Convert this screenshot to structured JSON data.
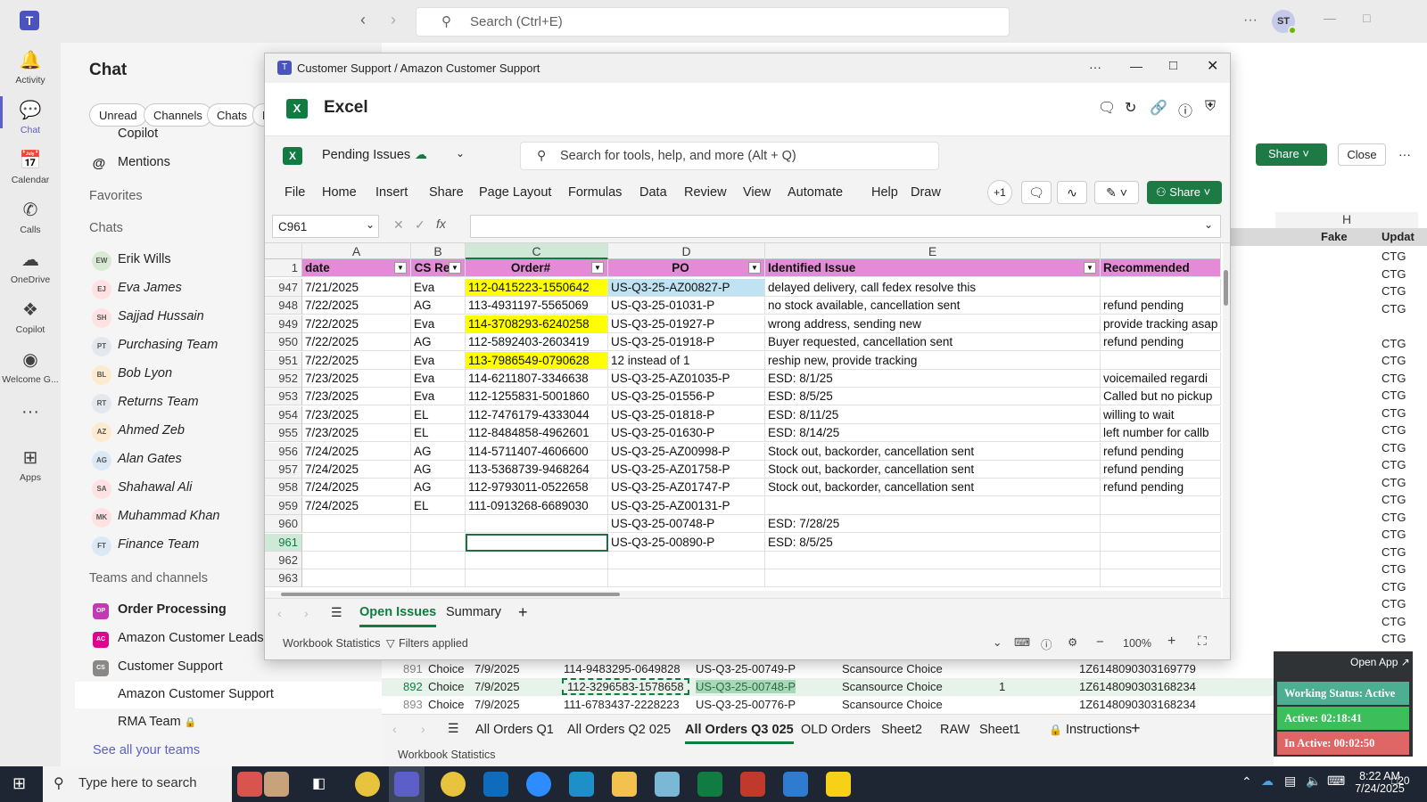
{
  "teams": {
    "search_placeholder": "Search (Ctrl+E)",
    "avatar": "ST",
    "rail": [
      "Activity",
      "Chat",
      "Calendar",
      "Calls",
      "OneDrive",
      "Copilot",
      "Welcome G...",
      "Apps"
    ],
    "chat_title": "Chat",
    "filters": [
      "Unread",
      "Channels",
      "Chats",
      "M"
    ],
    "copilot": "Copilot",
    "mentions": "Mentions",
    "favorites": "Favorites",
    "chats_header": "Chats",
    "chats": [
      {
        "initials": "EW",
        "name": "Erik Wills",
        "color": "#d9ead3"
      },
      {
        "initials": "EJ",
        "name": "Eva James",
        "color": "#fde2e1"
      },
      {
        "initials": "SH",
        "name": "Sajjad Hussain",
        "color": "#fde2e1"
      },
      {
        "initials": "PT",
        "name": "Purchasing Team",
        "color": "#e3e8ef"
      },
      {
        "initials": "BL",
        "name": "Bob Lyon",
        "color": "#fdebd0"
      },
      {
        "initials": "RT",
        "name": "Returns Team",
        "color": "#e3e8ef"
      },
      {
        "initials": "AZ",
        "name": "Ahmed Zeb",
        "color": "#fdebd0"
      },
      {
        "initials": "AG",
        "name": "Alan Gates",
        "color": "#dbe8f5"
      },
      {
        "initials": "SA",
        "name": "Shahawal Ali",
        "color": "#fde2e1"
      },
      {
        "initials": "MK",
        "name": "Muhammad Khan",
        "color": "#fde2e1"
      },
      {
        "initials": "FT",
        "name": "Finance Team",
        "color": "#dbe8f5"
      }
    ],
    "teams_header": "Teams and channels",
    "channels": [
      {
        "initials": "OP",
        "name": "Order Processing",
        "color": "#c239b3"
      },
      {
        "initials": "AC",
        "name": "Amazon Customer Leads",
        "color": "#e3008c"
      },
      {
        "initials": "CS",
        "name": "Customer Support",
        "color": "#8a8886"
      },
      {
        "initials": "",
        "name": "Amazon Customer Support",
        "color": ""
      },
      {
        "initials": "",
        "name": "RMA Team",
        "color": ""
      }
    ],
    "see_all": "See all your teams",
    "right_share": "Share",
    "right_close": "Close"
  },
  "window": {
    "title": "Customer Support / Amazon Customer Support",
    "app": "Excel",
    "file_name": "Pending Issues",
    "search_placeholder": "Search for tools, help, and more (Alt + Q)",
    "menus": [
      "File",
      "Home",
      "Insert",
      "Share",
      "Page Layout",
      "Formulas",
      "Data",
      "Review",
      "View",
      "Automate",
      "Help",
      "Draw"
    ],
    "collab": "+1",
    "share": "Share",
    "name_box": "C961",
    "fx": "fx",
    "columns": [
      "A",
      "B",
      "C",
      "D",
      "E"
    ],
    "header_row": {
      "num": "1",
      "date": "date",
      "cs": "CS Re",
      "order": "Order#",
      "po": "PO",
      "issue": "Identified Issue",
      "rec": "Recommended"
    },
    "rows": [
      {
        "n": "947",
        "date": "7/21/2025",
        "cs": "Eva",
        "order": "112-0415223-1550642",
        "po": "US-Q3-25-AZ00827-P",
        "issue": "delayed delivery, call fedex resolve this",
        "rec": "",
        "hl": "yel",
        "pohl": "blu"
      },
      {
        "n": "948",
        "date": "7/22/2025",
        "cs": "AG",
        "order": "113-4931197-5565069",
        "po": "US-Q3-25-01031-P",
        "issue": "no stock available, cancellation sent",
        "rec": "refund pending",
        "hl": "",
        "pohl": ""
      },
      {
        "n": "949",
        "date": "7/22/2025",
        "cs": "Eva",
        "order": "114-3708293-6240258",
        "po": "US-Q3-25-01927-P",
        "issue": "wrong address, sending new",
        "rec": "provide tracking asap",
        "hl": "yel",
        "pohl": ""
      },
      {
        "n": "950",
        "date": "7/22/2025",
        "cs": "AG",
        "order": "112-5892403-2603419",
        "po": "US-Q3-25-01918-P",
        "issue": "Buyer requested, cancellation sent",
        "rec": "refund pending",
        "hl": "",
        "pohl": ""
      },
      {
        "n": "951",
        "date": "7/22/2025",
        "cs": "Eva",
        "order": "113-7986549-0790628",
        "po": "12 instead of 1",
        "issue": "reship new, provide tracking",
        "rec": "",
        "hl": "yel",
        "pohl": ""
      },
      {
        "n": "952",
        "date": "7/23/2025",
        "cs": "Eva",
        "order": "114-6211807-3346638",
        "po": "US-Q3-25-AZ01035-P",
        "issue": " ESD: 8/1/25",
        "rec": "voicemailed regardi",
        "hl": "",
        "pohl": ""
      },
      {
        "n": "953",
        "date": "7/23/2025",
        "cs": "Eva",
        "order": "112-1255831-5001860",
        "po": "US-Q3-25-01556-P",
        "issue": "ESD: 8/5/25",
        "rec": "Called but no pickup",
        "hl": "",
        "pohl": ""
      },
      {
        "n": "954",
        "date": "7/23/2025",
        "cs": "EL",
        "order": "112-7476179-4333044",
        "po": "US-Q3-25-01818-P",
        "issue": "ESD: 8/11/25",
        "rec": "willing to wait",
        "hl": "",
        "pohl": ""
      },
      {
        "n": "955",
        "date": "7/23/2025",
        "cs": "EL",
        "order": "112-8484858-4962601",
        "po": "US-Q3-25-01630-P",
        "issue": " ESD: 8/14/25",
        "rec": "left number for callb",
        "hl": "",
        "pohl": ""
      },
      {
        "n": "956",
        "date": "7/24/2025",
        "cs": "AG",
        "order": "114-5711407-4606600",
        "po": "US-Q3-25-AZ00998-P",
        "issue": "Stock out, backorder, cancellation sent",
        "rec": "refund pending",
        "hl": "",
        "pohl": ""
      },
      {
        "n": "957",
        "date": "7/24/2025",
        "cs": "AG",
        "order": "113-5368739-9468264",
        "po": "US-Q3-25-AZ01758-P",
        "issue": "Stock out, backorder, cancellation sent",
        "rec": "refund pending",
        "hl": "",
        "pohl": ""
      },
      {
        "n": "958",
        "date": "7/24/2025",
        "cs": "AG",
        "order": "112-9793011-0522658",
        "po": "US-Q3-25-AZ01747-P",
        "issue": "Stock out, backorder, cancellation sent",
        "rec": "refund pending",
        "hl": "",
        "pohl": ""
      },
      {
        "n": "959",
        "date": "7/24/2025",
        "cs": "EL",
        "order": "111-0913268-6689030",
        "po": "US-Q3-25-AZ00131-P",
        "issue": "",
        "rec": "",
        "hl": "",
        "pohl": ""
      },
      {
        "n": "960",
        "date": "",
        "cs": "",
        "order": "",
        "po": "US-Q3-25-00748-P",
        "issue": "ESD: 7/28/25",
        "rec": "",
        "hl": "",
        "pohl": ""
      },
      {
        "n": "961",
        "date": "",
        "cs": "",
        "order": "",
        "po": "US-Q3-25-00890-P",
        "issue": "ESD: 8/5/25",
        "rec": "",
        "hl": "",
        "pohl": "",
        "sel": true
      },
      {
        "n": "962",
        "date": "",
        "cs": "",
        "order": "",
        "po": "",
        "issue": "",
        "rec": "",
        "hl": "",
        "pohl": ""
      },
      {
        "n": "963",
        "date": "",
        "cs": "",
        "order": "",
        "po": "",
        "issue": "",
        "rec": "",
        "hl": "",
        "pohl": ""
      }
    ],
    "sheet_tabs": [
      "Open Issues",
      "Summary"
    ],
    "status_left": "Workbook Statistics",
    "filters_applied": "Filters applied",
    "zoom": "100%"
  },
  "background_sheet": {
    "col_h": "H",
    "fake": "Fake",
    "updat": "Updat",
    "ctg": "CTG",
    "rows": [
      {
        "n": "891",
        "a": "Choice",
        "b": "7/9/2025",
        "c": "114-9483295-0649828",
        "d": "US-Q3-25-00749-P",
        "e": "Scansource Choice",
        "f": "",
        "g": "1Z6148090303169779"
      },
      {
        "n": "892",
        "a": "Choice",
        "b": "7/9/2025",
        "c": "112-3296583-1578658",
        "d": "US-Q3-25-00748-P",
        "e": "Scansource Choice",
        "f": "1",
        "g": "1Z6148090303168234"
      },
      {
        "n": "893",
        "a": "Choice",
        "b": "7/9/2025",
        "c": "111-6783437-2228223",
        "d": "US-Q3-25-00776-P",
        "e": "Scansource Choice",
        "f": "",
        "g": "1Z6148090303168234"
      }
    ],
    "tabs": [
      "All Orders Q1",
      "All Orders Q2 025",
      "All Orders Q3 025",
      "OLD Orders",
      "Sheet2",
      "RAW",
      "Sheet1",
      "Instructions"
    ],
    "status": "Workbook Statistics"
  },
  "widget": {
    "open_app": "Open App",
    "status": "Working Status: Active",
    "active": "Active: 02:18:41",
    "inactive": "In Active: 00:02:50"
  },
  "taskbar": {
    "search": "Type here to search",
    "time": "8:22 AM",
    "date": "7/24/2025",
    "notif": "20"
  }
}
